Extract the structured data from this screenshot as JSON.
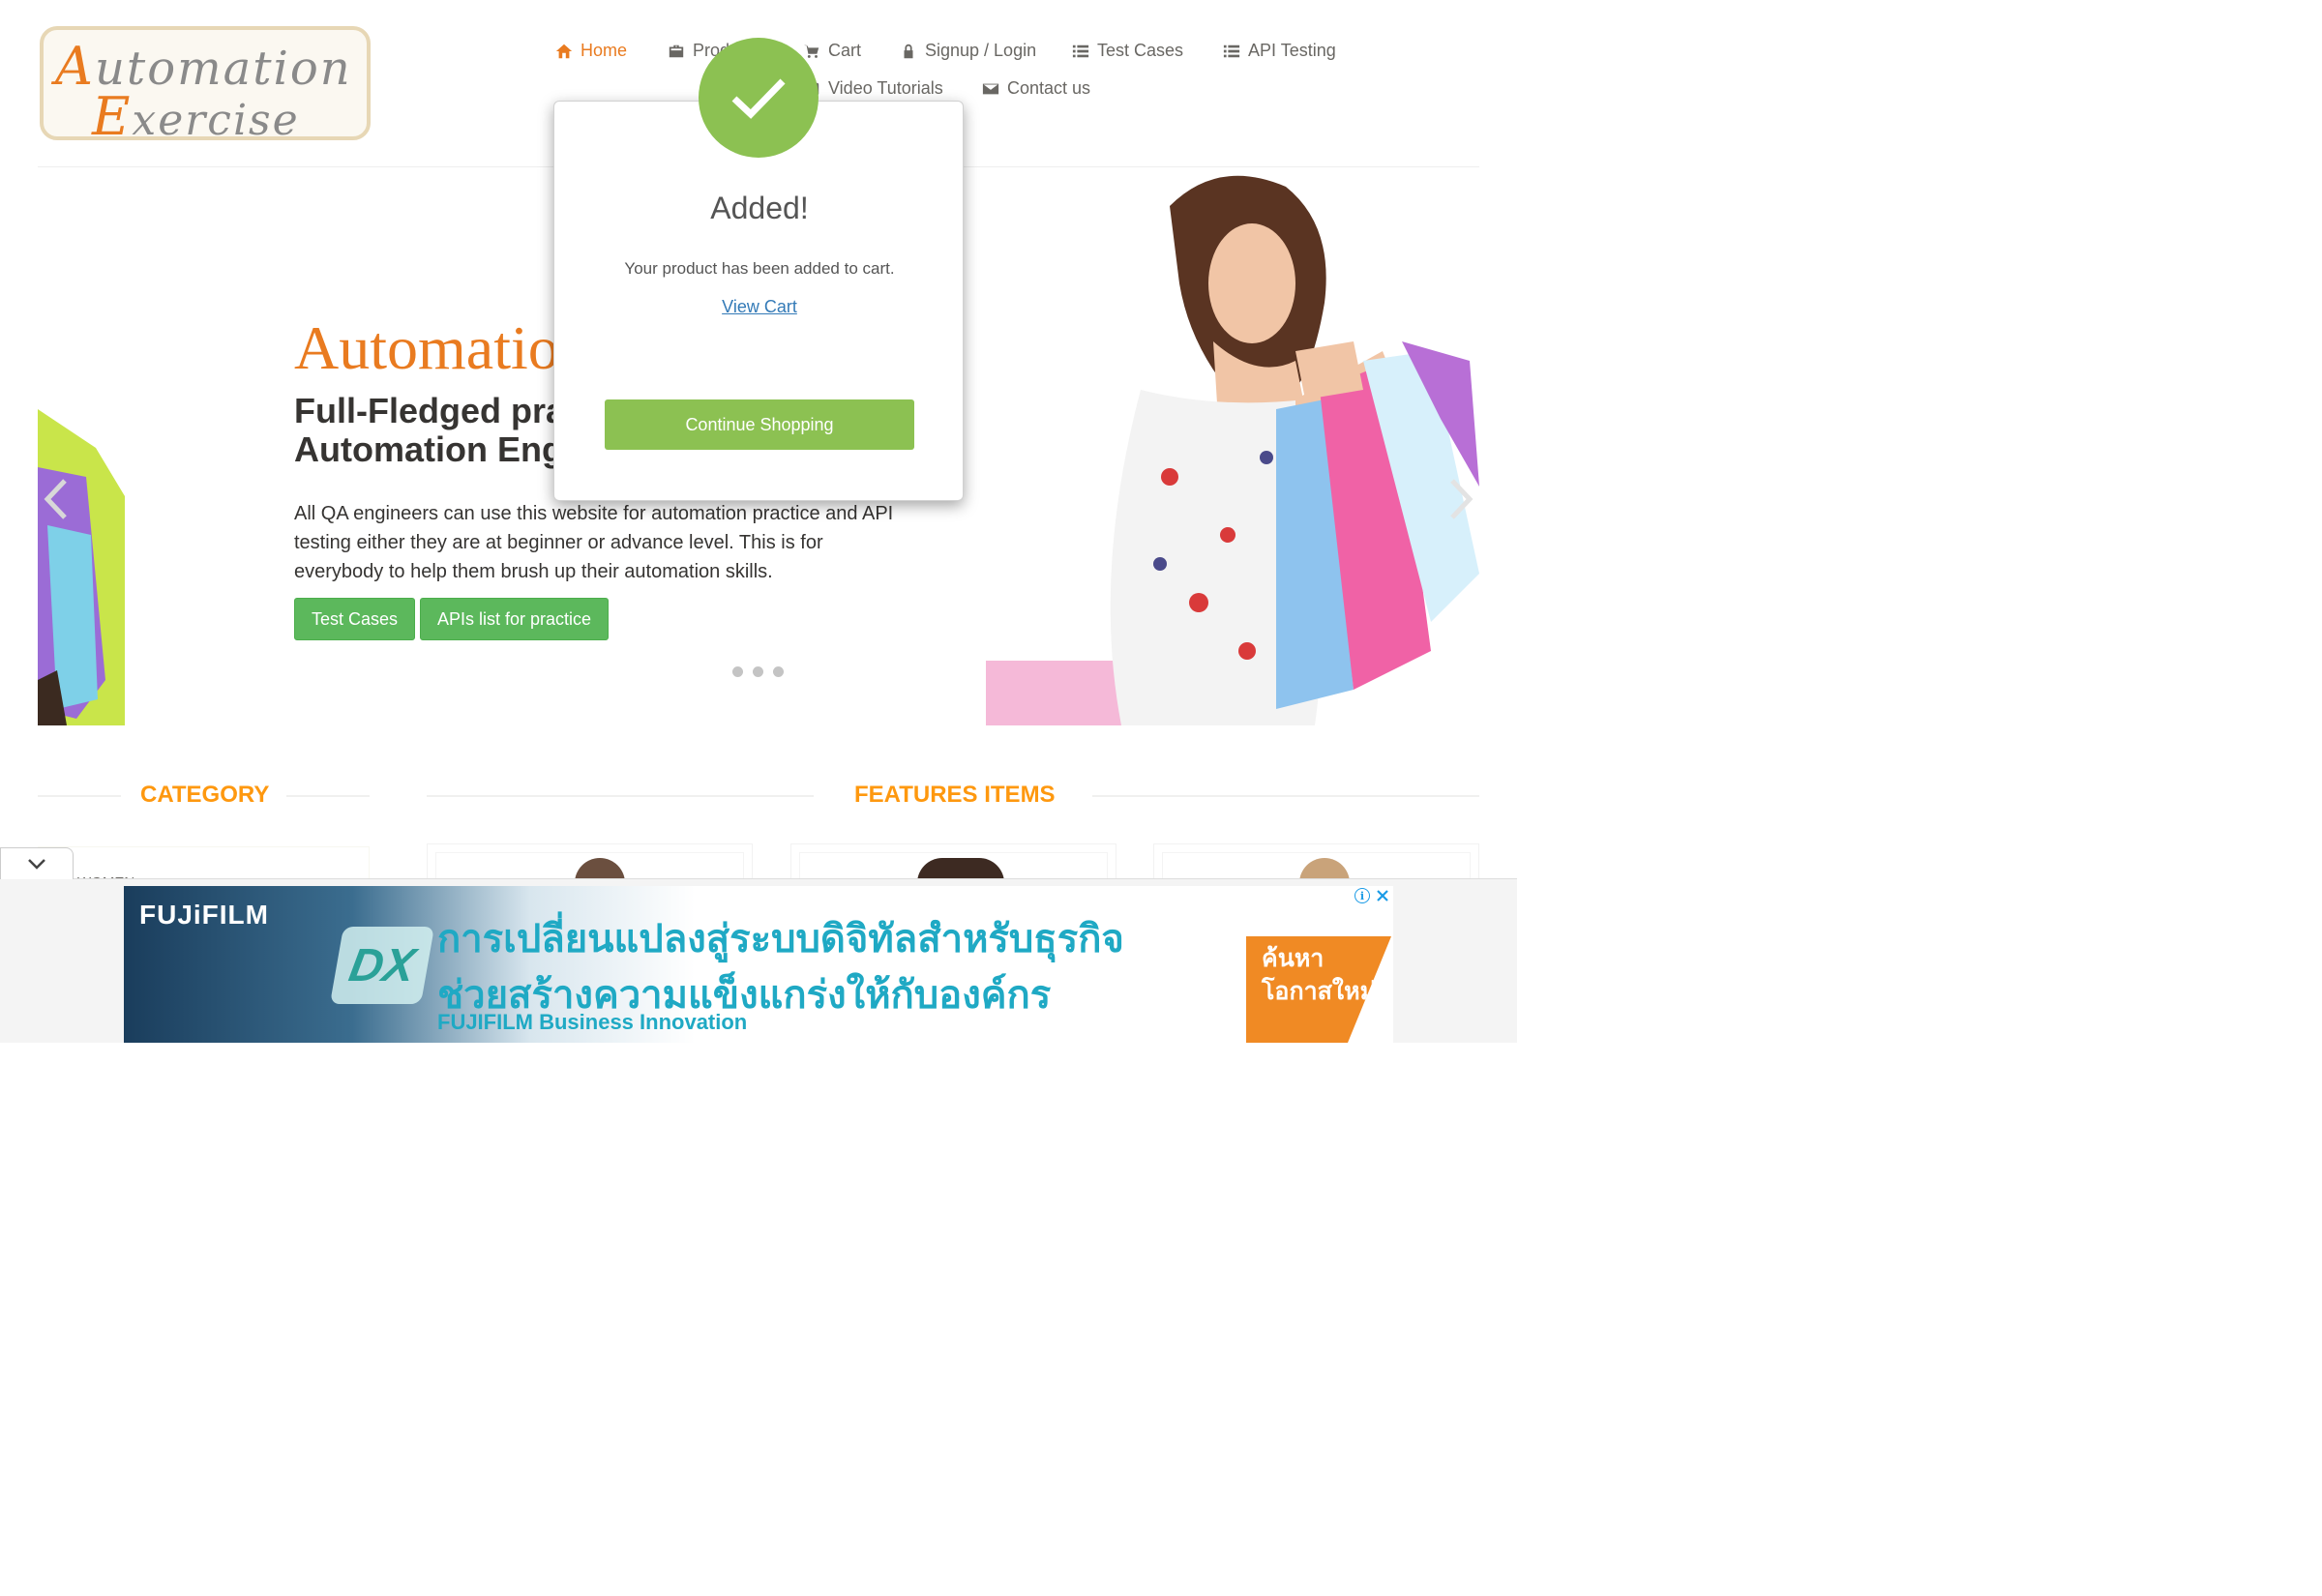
{
  "logo": {
    "line1_cap": "A",
    "line1_rest": "utomation",
    "line2_cap": "E",
    "line2_rest": "xercise"
  },
  "nav": {
    "items": [
      {
        "label": "Home",
        "icon": "home-icon"
      },
      {
        "label": "Products",
        "icon": "briefcase-icon"
      },
      {
        "label": "Cart",
        "icon": "cart-icon"
      },
      {
        "label": "Signup / Login",
        "icon": "lock-icon"
      },
      {
        "label": "Test Cases",
        "icon": "list-icon"
      },
      {
        "label": "API Testing",
        "icon": "list-icon"
      },
      {
        "label": "Video Tutorials",
        "icon": "youtube-icon"
      },
      {
        "label": "Contact us",
        "icon": "envelope-icon"
      }
    ],
    "active_color": "#e97b20"
  },
  "hero": {
    "title": "AutomationExercise",
    "subtitle_line1": "Full-Fledged practice website for",
    "subtitle_line2": "Automation Engineers",
    "description": "All QA engineers can use this website for automation practice and API testing either they are at beginner or advance level. This is for everybody to help them brush up their automation skills.",
    "btn_test_cases": "Test Cases",
    "btn_apis": "APIs list for practice"
  },
  "sections": {
    "category_title": "CATEGORY",
    "features_title": "FEATURES ITEMS",
    "category_first_item": "WOMEN"
  },
  "modal": {
    "title": "Added!",
    "message": "Your product has been added to cart.",
    "link": "View Cart",
    "button": "Continue Shopping",
    "accent": "#8cc152"
  },
  "ad": {
    "brand": "FUJiFILM",
    "badge": "DX",
    "line1": "การเปลี่ยนแปลงสู่ระบบดิจิทัลสำหรับธุรกิจ",
    "line2": "ช่วยสร้างความแข็งแกร่งให้กับองค์กร",
    "line3": "FUJIFILM Business Innovation",
    "cta": "ค้นหาโอกาสใหม่",
    "info_glyph": "i"
  }
}
